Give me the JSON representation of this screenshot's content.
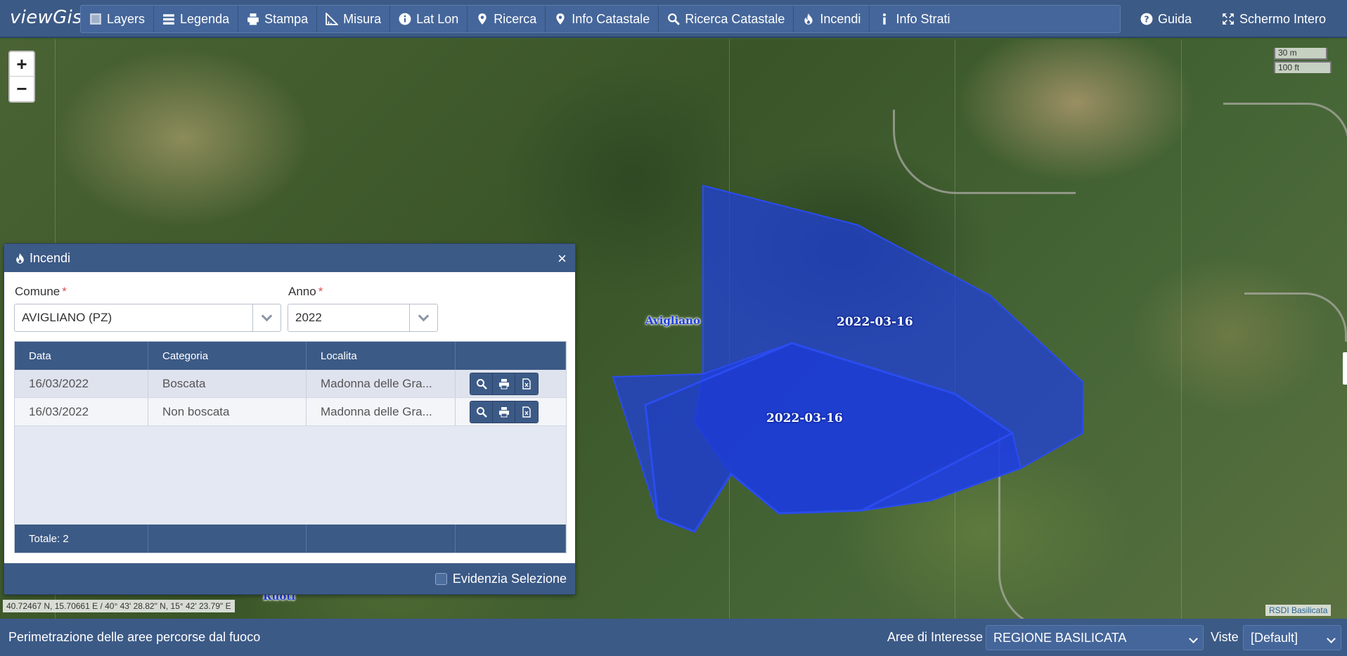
{
  "brand": "viewGis",
  "menu": [
    {
      "label": "Layers",
      "icon": "layers-icon"
    },
    {
      "label": "Legenda",
      "icon": "list-icon"
    },
    {
      "label": "Stampa",
      "icon": "print-icon"
    },
    {
      "label": "Misura",
      "icon": "ruler-icon"
    },
    {
      "label": "Lat Lon",
      "icon": "info-circle-icon"
    },
    {
      "label": "Ricerca",
      "icon": "map-marker-icon"
    },
    {
      "label": "Info Catastale",
      "icon": "map-marker-icon"
    },
    {
      "label": "Ricerca Catastale",
      "icon": "search-icon"
    },
    {
      "label": "Incendi",
      "icon": "fire-icon"
    },
    {
      "label": "Info Strati",
      "icon": "info-icon"
    }
  ],
  "right_menu": {
    "guida": "Guida",
    "fullscreen": "Schermo Intero"
  },
  "map": {
    "zoom_in": "+",
    "zoom_out": "−",
    "scale_metric": "30 m",
    "scale_imperial": "100 ft",
    "coords": "40.72467 N, 15.70661 E / 40° 43' 28.82\" N, 15° 42' 23.79\" E",
    "attribution": "RSDI Basilicata",
    "place_labels": {
      "avigliano": "Avigliano",
      "ruoti": "Ruoti"
    },
    "polygon_labels": [
      "2022-03-16",
      "2022-03-16"
    ],
    "polygon_color": "#1f3fe0"
  },
  "panel": {
    "title": "Incendi",
    "close": "×",
    "comune_label": "Comune",
    "comune_value": "AVIGLIANO (PZ)",
    "anno_label": "Anno",
    "anno_value": "2022",
    "required_mark": "*",
    "columns": [
      "Data",
      "Categoria",
      "Localita",
      ""
    ],
    "rows": [
      {
        "data": "16/03/2022",
        "categoria": "Boscata",
        "localita": "Madonna delle Gra..."
      },
      {
        "data": "16/03/2022",
        "categoria": "Non boscata",
        "localita": "Madonna delle Gra..."
      }
    ],
    "totale": "Totale: 2",
    "evidenzia": "Evidenzia Selezione"
  },
  "bottom": {
    "status": "Perimetrazione delle aree percorse dal fuoco",
    "aree_label": "Aree di Interesse",
    "aree_value": "REGIONE BASILICATA",
    "viste_label": "Viste",
    "viste_value": "[Default]"
  },
  "colors": {
    "navbar": "#3c5a86",
    "accent_required": "#d9534f"
  }
}
